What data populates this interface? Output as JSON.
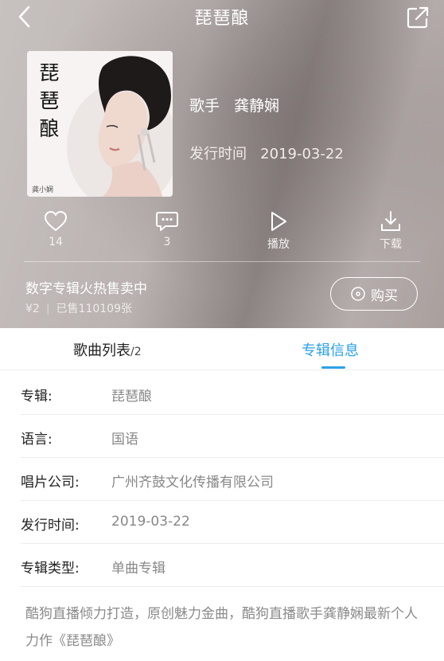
{
  "header": {
    "title": "琵琶酿",
    "back_icon": "chevron-left-icon",
    "share_icon": "share-icon"
  },
  "album": {
    "cover_title": "琵琶酿",
    "cover_signature": "龚小娴",
    "artist_label": "歌手",
    "artist_name": "龚静娴",
    "release_label": "发行时间",
    "release_date": "2019-03-22"
  },
  "actions": [
    {
      "icon": "heart-icon",
      "label": "14"
    },
    {
      "icon": "comment-icon",
      "label": "3"
    },
    {
      "icon": "play-icon",
      "label": "播放"
    },
    {
      "icon": "download-icon",
      "label": "下载"
    }
  ],
  "promo": {
    "title": "数字专辑火热售卖中",
    "price": "¥2",
    "sold": "已售110109张",
    "buy_label": "购买",
    "buy_icon": "disc-icon"
  },
  "tabs": {
    "songs_label": "歌曲列表",
    "songs_count": "/2",
    "info_label": "专辑信息",
    "active": "info",
    "accent_color": "#2aa0e8"
  },
  "info": [
    {
      "label": "专辑:",
      "value": "琵琶酿"
    },
    {
      "label": "语言:",
      "value": "国语"
    },
    {
      "label": "唱片公司:",
      "value": "广州齐鼓文化传播有限公司"
    },
    {
      "label": "发行时间:",
      "value": "2019-03-22"
    },
    {
      "label": "专辑类型:",
      "value": "单曲专辑"
    }
  ],
  "description": "酷狗直播倾力打造，原创魅力金曲，酷狗直播歌手龚静娴最新个人力作《琵琶酿》"
}
